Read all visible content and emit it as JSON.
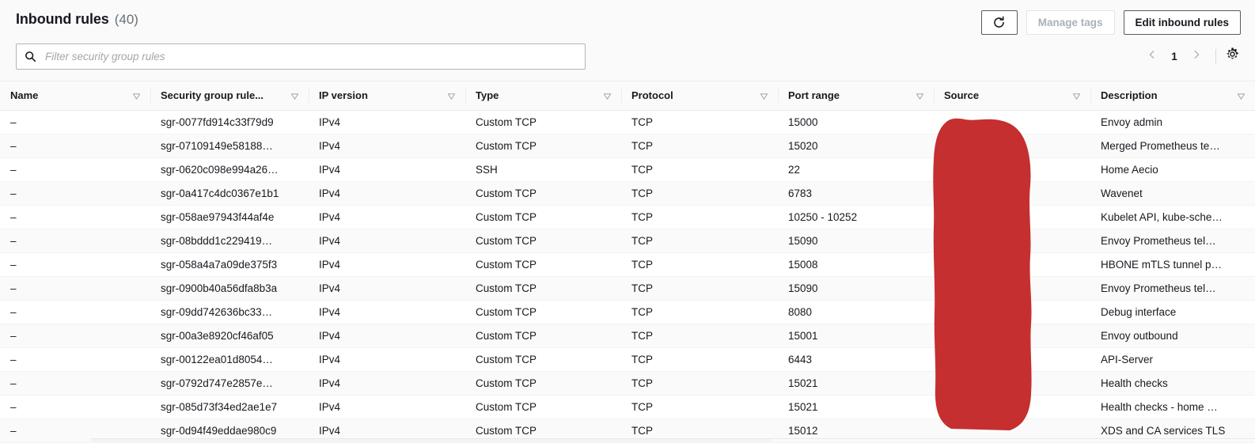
{
  "header": {
    "title": "Inbound rules",
    "count": "(40)",
    "refresh_icon": "refresh-icon",
    "manage_tags_label": "Manage tags",
    "edit_rules_label": "Edit inbound rules"
  },
  "filter": {
    "search_icon": "search-icon",
    "placeholder": "Filter security group rules",
    "value": ""
  },
  "pagination": {
    "prev_icon": "chevron-left-icon",
    "page": "1",
    "next_icon": "chevron-right-icon",
    "settings_icon": "gear-icon"
  },
  "table": {
    "columns": [
      {
        "label": "Name",
        "sort_icon": "sort-icon"
      },
      {
        "label": "Security group rule...",
        "sort_icon": "sort-icon"
      },
      {
        "label": "IP version",
        "sort_icon": "sort-icon"
      },
      {
        "label": "Type",
        "sort_icon": "sort-icon"
      },
      {
        "label": "Protocol",
        "sort_icon": "sort-icon"
      },
      {
        "label": "Port range",
        "sort_icon": "sort-icon"
      },
      {
        "label": "Source",
        "sort_icon": "sort-icon"
      },
      {
        "label": "Description",
        "sort_icon": "sort-icon"
      }
    ],
    "rows": [
      {
        "name": "–",
        "rule_id": "sgr-0077fd914c33f79d9",
        "ip_version": "IPv4",
        "type": "Custom TCP",
        "protocol": "TCP",
        "port_range": "15000",
        "source": "",
        "description": "Envoy admin"
      },
      {
        "name": "–",
        "rule_id": "sgr-07109149e58188…",
        "ip_version": "IPv4",
        "type": "Custom TCP",
        "protocol": "TCP",
        "port_range": "15020",
        "source": "",
        "description": "Merged Prometheus te…"
      },
      {
        "name": "–",
        "rule_id": "sgr-0620c098e994a26…",
        "ip_version": "IPv4",
        "type": "SSH",
        "protocol": "TCP",
        "port_range": "22",
        "source": "",
        "description": "Home Aecio"
      },
      {
        "name": "–",
        "rule_id": "sgr-0a417c4dc0367e1b1",
        "ip_version": "IPv4",
        "type": "Custom TCP",
        "protocol": "TCP",
        "port_range": "6783",
        "source": "",
        "description": "Wavenet"
      },
      {
        "name": "–",
        "rule_id": "sgr-058ae97943f44af4e",
        "ip_version": "IPv4",
        "type": "Custom TCP",
        "protocol": "TCP",
        "port_range": "10250 - 10252",
        "source": "",
        "description": "Kubelet API, kube-sche…"
      },
      {
        "name": "–",
        "rule_id": "sgr-08bddd1c229419…",
        "ip_version": "IPv4",
        "type": "Custom TCP",
        "protocol": "TCP",
        "port_range": "15090",
        "source": "",
        "description": "Envoy Prometheus tel…"
      },
      {
        "name": "–",
        "rule_id": "sgr-058a4a7a09de375f3",
        "ip_version": "IPv4",
        "type": "Custom TCP",
        "protocol": "TCP",
        "port_range": "15008",
        "source": "",
        "description": "HBONE mTLS tunnel p…"
      },
      {
        "name": "–",
        "rule_id": "sgr-0900b40a56dfa8b3a",
        "ip_version": "IPv4",
        "type": "Custom TCP",
        "protocol": "TCP",
        "port_range": "15090",
        "source": "",
        "description": "Envoy Prometheus tel…"
      },
      {
        "name": "–",
        "rule_id": "sgr-09dd742636bc33…",
        "ip_version": "IPv4",
        "type": "Custom TCP",
        "protocol": "TCP",
        "port_range": "8080",
        "source": "",
        "description": "Debug interface"
      },
      {
        "name": "–",
        "rule_id": "sgr-00a3e8920cf46af05",
        "ip_version": "IPv4",
        "type": "Custom TCP",
        "protocol": "TCP",
        "port_range": "15001",
        "source": "",
        "description": "Envoy outbound"
      },
      {
        "name": "–",
        "rule_id": "sgr-00122ea01d8054…",
        "ip_version": "IPv4",
        "type": "Custom TCP",
        "protocol": "TCP",
        "port_range": "6443",
        "source": "",
        "description": "API-Server"
      },
      {
        "name": "–",
        "rule_id": "sgr-0792d747e2857e…",
        "ip_version": "IPv4",
        "type": "Custom TCP",
        "protocol": "TCP",
        "port_range": "15021",
        "source": "",
        "description": "Health checks"
      },
      {
        "name": "–",
        "rule_id": "sgr-085d73f34ed2ae1e7",
        "ip_version": "IPv4",
        "type": "Custom TCP",
        "protocol": "TCP",
        "port_range": "15021",
        "source": "",
        "description": "Health checks - home …"
      },
      {
        "name": "–",
        "rule_id": "sgr-0d94f49eddae980c9",
        "ip_version": "IPv4",
        "type": "Custom TCP",
        "protocol": "TCP",
        "port_range": "15012",
        "source": "",
        "description": "XDS and CA services TLS"
      }
    ]
  },
  "redaction": {
    "label": "source-column-redaction",
    "color": "#c62f2f"
  }
}
